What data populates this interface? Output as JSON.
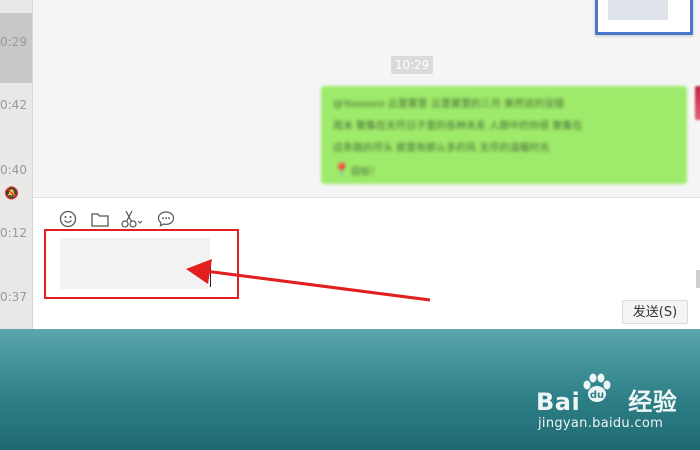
{
  "sidebar": {
    "times": [
      "0:29",
      "0:42",
      "0:40",
      "0:12",
      "0:37"
    ]
  },
  "messages": {
    "time_chip": "10:29",
    "bubble": {
      "lines": [
        "@Yoooooo   云里雾里 云里雾里的三月 果然说的没错",
        "周末 聚集在无尽日子里的各种关系 人群中的你很 聚集在",
        "这条路的尽头 那里有那么多的风 无尽的温暖时光",
        "目标！"
      ]
    }
  },
  "composer": {
    "tools": [
      "emoji-icon",
      "folder-icon",
      "scissors-icon",
      "chat-bubble-icon"
    ],
    "send_label": "发送(S)"
  },
  "watermark": {
    "logo_left": "Bai",
    "logo_right": "经验",
    "url": "jingyan.baidu.com"
  },
  "colors": {
    "bubble": "#9eea6a",
    "annotation": "#e21e1e",
    "teal": "#2f8088"
  }
}
